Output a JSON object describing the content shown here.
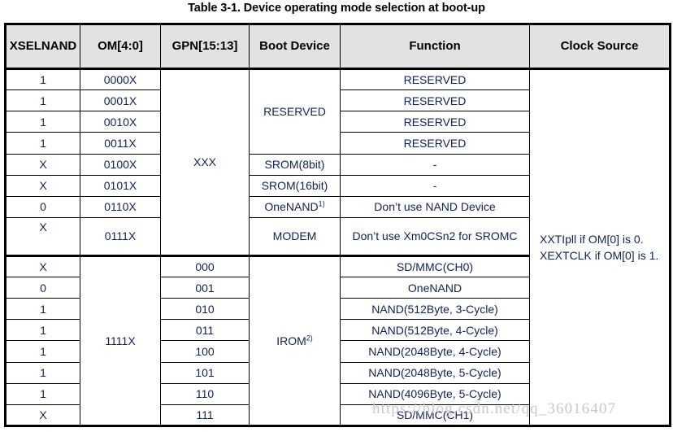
{
  "caption": "Table 3-1. Device operating mode selection at boot-up",
  "table": {
    "headers": {
      "xselnand": "XSELNAND",
      "om": "OM[4:0]",
      "gpn": "GPN[15:13]",
      "boot_device": "Boot Device",
      "function": "Function",
      "clock_source": "Clock Source"
    },
    "group_a": {
      "gpn_value": "XXX",
      "reserved_boot_label": "RESERVED",
      "rows": [
        {
          "xselnand": "1",
          "om": "0000X",
          "function": "RESERVED"
        },
        {
          "xselnand": "1",
          "om": "0001X",
          "function": "RESERVED"
        },
        {
          "xselnand": "1",
          "om": "0010X",
          "function": "RESERVED"
        },
        {
          "xselnand": "1",
          "om": "0011X",
          "function": "RESERVED"
        },
        {
          "xselnand": "X",
          "om": "0100X",
          "boot_device": "SROM(8bit)",
          "function": "-"
        },
        {
          "xselnand": "X",
          "om": "0101X",
          "boot_device": "SROM(16bit)",
          "boot_device_sup": "",
          "function": "-"
        },
        {
          "xselnand": "0",
          "om": "0110X",
          "boot_device": "OneNAND",
          "boot_device_sup": "1)",
          "function": "Don’t use NAND Device"
        },
        {
          "xselnand": "X",
          "om": "0111X",
          "boot_device": "MODEM",
          "function": "Don’t use Xm0CSn2 for SROMC"
        }
      ]
    },
    "group_b": {
      "om_value": "1111X",
      "boot_device": "IROM",
      "boot_device_sup": "2)",
      "rows": [
        {
          "xselnand": "X",
          "gpn": "000",
          "function": "SD/MMC(CH0)"
        },
        {
          "xselnand": "0",
          "gpn": "001",
          "function": "OneNAND"
        },
        {
          "xselnand": "1",
          "gpn": "010",
          "function": "NAND(512Byte, 3-Cycle)"
        },
        {
          "xselnand": "1",
          "gpn": "011",
          "function": "NAND(512Byte, 4-Cycle)"
        },
        {
          "xselnand": "1",
          "gpn": "100",
          "function": "NAND(2048Byte, 4-Cycle)"
        },
        {
          "xselnand": "1",
          "gpn": "101",
          "function": "NAND(2048Byte, 5-Cycle)"
        },
        {
          "xselnand": "1",
          "gpn": "110",
          "function": "NAND(4096Byte, 5-Cycle)"
        },
        {
          "xselnand": "X",
          "gpn": "111",
          "function": "SD/MMC(CH1)"
        }
      ]
    },
    "clock_source_value": "XXTIpll if OM[0] is 0. XEXTCLK if OM[0] is 1."
  },
  "watermark": "https://blog.csdn.net/qq_36016407",
  "colors": {
    "header_bg": "#e2e2e2",
    "border": "#000000",
    "text": "#11224d",
    "watermark": "#c9c9c9"
  }
}
